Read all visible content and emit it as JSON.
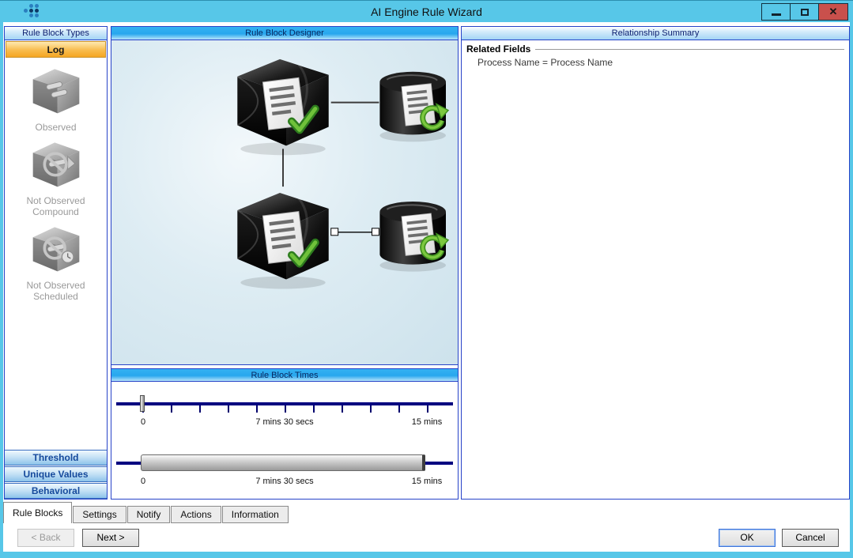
{
  "window": {
    "title": "AI Engine Rule Wizard",
    "close_glyph": "✕"
  },
  "rule_block_types": {
    "header": "Rule Block Types",
    "selected_category": "Log",
    "items": [
      {
        "icon": "observed-cube-icon",
        "label": "Observed"
      },
      {
        "icon": "not-observed-compound-cube-icon",
        "label": "Not Observed Compound"
      },
      {
        "icon": "not-observed-scheduled-cube-icon",
        "label": "Not Observed Scheduled"
      }
    ],
    "categories": [
      {
        "label": "Threshold"
      },
      {
        "label": "Unique Values"
      },
      {
        "label": "Behavioral"
      }
    ]
  },
  "designer": {
    "header": "Rule Block Designer",
    "nodes": [
      {
        "icon": "log-observed-block-cube-icon"
      },
      {
        "icon": "log-source-cylinder-icon"
      },
      {
        "icon": "log-observed-block-cube-icon"
      },
      {
        "icon": "log-source-cylinder-icon"
      }
    ]
  },
  "times": {
    "header": "Rule Block Times",
    "slider_top": {
      "labels": [
        "0",
        "7 mins 30 secs",
        "15 mins"
      ]
    },
    "slider_bottom": {
      "labels": [
        "0",
        "7 mins 30 secs",
        "15 mins"
      ]
    }
  },
  "summary": {
    "header": "Relationship Summary",
    "section": "Related Fields",
    "relation": "Process Name = Process Name"
  },
  "tabs": {
    "items": [
      {
        "label": "Rule Blocks",
        "active": true
      },
      {
        "label": "Settings"
      },
      {
        "label": "Notify"
      },
      {
        "label": "Actions"
      },
      {
        "label": "Information"
      }
    ]
  },
  "footer": {
    "back": "< Back",
    "next": "Next >",
    "ok": "OK",
    "cancel": "Cancel"
  },
  "colors": {
    "titlebar": "#57c7e8",
    "close_button": "#c9504c",
    "log_accent": "#f5a623",
    "header_blue": "#28a7ee",
    "navy_track": "#00007f"
  }
}
